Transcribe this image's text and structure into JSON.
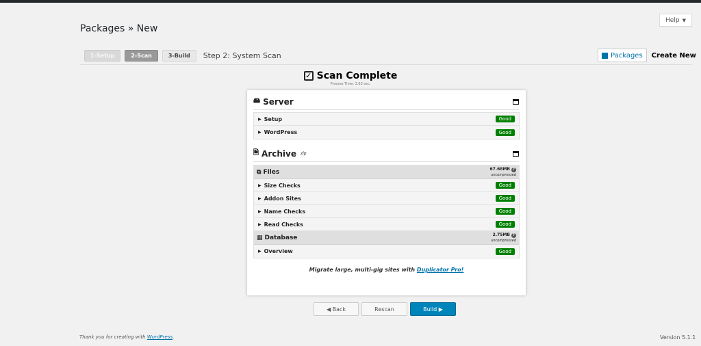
{
  "help": {
    "label": "Help",
    "caret": "▼"
  },
  "page_title": "Packages » New",
  "steps": [
    {
      "label": "1-Setup",
      "state": "done"
    },
    {
      "label": "2-Scan",
      "state": "active"
    },
    {
      "label": "3-Build",
      "state": "todo"
    }
  ],
  "step_title": "Step 2: System Scan",
  "header_links": {
    "packages": "Packages",
    "create_new": "Create New"
  },
  "scan": {
    "title": "Scan Complete",
    "process_time": "Process Time: 3.63 sec."
  },
  "server": {
    "title": "Server",
    "rows": [
      {
        "label": "Setup",
        "status": "Good"
      },
      {
        "label": "WordPress",
        "status": "Good"
      }
    ]
  },
  "archive": {
    "title": "Archive",
    "sup": "zip",
    "files": {
      "title": "Files",
      "size": "67.68MB",
      "unit": "uncompressed",
      "rows": [
        {
          "label": "Size Checks",
          "status": "Good"
        },
        {
          "label": "Addon Sites",
          "status": "Good"
        },
        {
          "label": "Name Checks",
          "status": "Good"
        },
        {
          "label": "Read Checks",
          "status": "Good"
        }
      ]
    },
    "database": {
      "title": "Database",
      "size": "2.75MB",
      "unit": "uncompressed",
      "rows": [
        {
          "label": "Overview",
          "status": "Good"
        }
      ]
    }
  },
  "promo": {
    "text": "Migrate large, multi-gig sites with ",
    "link": "Duplicator Pro!"
  },
  "buttons": {
    "back": "◀ Back",
    "rescan": "Rescan",
    "build": "Build ▶"
  },
  "footer": {
    "left_text": "Thank you for creating with ",
    "left_link": "WordPress",
    "left_end": ".",
    "version": "Version 5.1.1"
  },
  "colors": {
    "good_badge": "#008000",
    "primary": "#0085ba",
    "link": "#0073aa"
  }
}
